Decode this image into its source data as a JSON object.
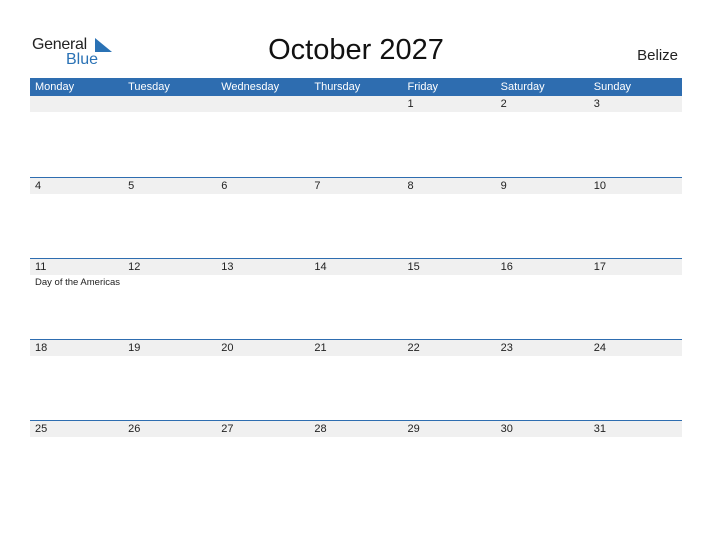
{
  "logo": {
    "text_general": "General",
    "text_blue": "Blue",
    "icon": "triangle-flag-icon",
    "accent": "#2a72b5"
  },
  "header": {
    "title": "October 2027",
    "country": "Belize"
  },
  "colors": {
    "header_bg": "#2e6db0",
    "daynum_bg": "#f0f0f0"
  },
  "weekdays": [
    "Monday",
    "Tuesday",
    "Wednesday",
    "Thursday",
    "Friday",
    "Saturday",
    "Sunday"
  ],
  "weeks": [
    {
      "days": [
        "",
        "",
        "",
        "",
        "1",
        "2",
        "3"
      ],
      "events": [
        "",
        "",
        "",
        "",
        "",
        "",
        ""
      ]
    },
    {
      "days": [
        "4",
        "5",
        "6",
        "7",
        "8",
        "9",
        "10"
      ],
      "events": [
        "",
        "",
        "",
        "",
        "",
        "",
        ""
      ]
    },
    {
      "days": [
        "11",
        "12",
        "13",
        "14",
        "15",
        "16",
        "17"
      ],
      "events": [
        "Day of the Americas",
        "",
        "",
        "",
        "",
        "",
        ""
      ]
    },
    {
      "days": [
        "18",
        "19",
        "20",
        "21",
        "22",
        "23",
        "24"
      ],
      "events": [
        "",
        "",
        "",
        "",
        "",
        "",
        ""
      ]
    },
    {
      "days": [
        "25",
        "26",
        "27",
        "28",
        "29",
        "30",
        "31"
      ],
      "events": [
        "",
        "",
        "",
        "",
        "",
        "",
        ""
      ]
    }
  ]
}
